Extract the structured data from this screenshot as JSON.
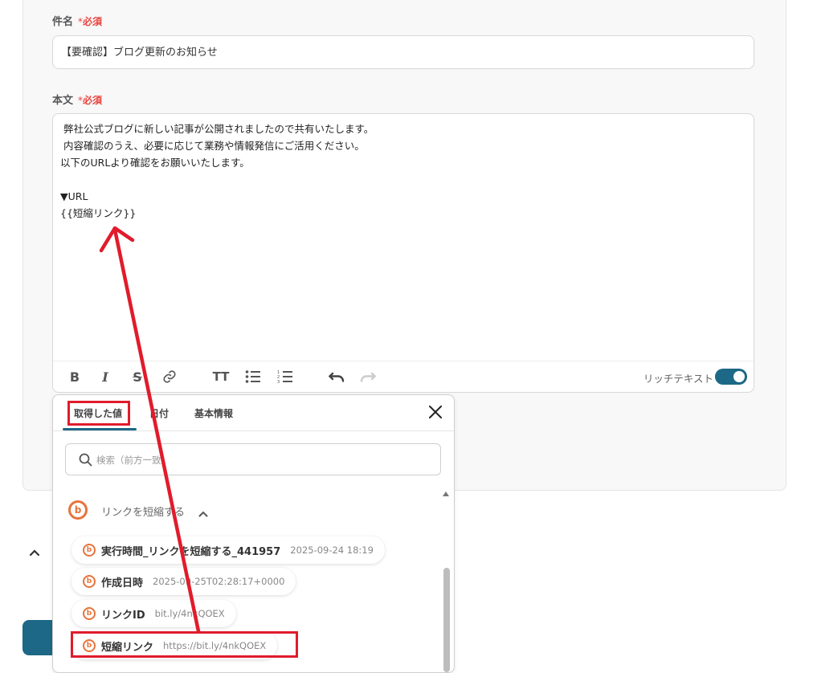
{
  "form": {
    "subject_label": "件名",
    "required_mark": "*",
    "required_text": "必須",
    "subject_value": "【要確認】ブログ更新のお知らせ",
    "body_label": "本文",
    "body_lines": [
      " 弊社公式ブログに新しい記事が公開されましたので共有いたします。",
      " 内容確認のうえ、必要に応じて業務や情報発信にご活用ください。",
      "以下のURLより確認をお願いいたします。",
      "",
      "▼URL",
      "{{短縮リンク}}"
    ],
    "rich_text_label": "リッチテキスト"
  },
  "popup": {
    "tabs": [
      "取得した値",
      "日付",
      "基本情報"
    ],
    "search_placeholder": "検索（前方一致）",
    "group_title": "リンクを短縮する",
    "items": [
      {
        "name": "実行時間_リンクを短縮する_441957",
        "value": "2025-09-24 18:19"
      },
      {
        "name": "作成日時",
        "value": "2025-09-25T02:28:17+0000"
      },
      {
        "name": "リンクID",
        "value": "bit.ly/4nkQOEX"
      },
      {
        "name": "短縮リンク",
        "value": "https://bit.ly/4nkQOEX"
      }
    ]
  },
  "colors": {
    "accent": "#1d6886",
    "required": "#e8433f",
    "bitly": "#e8733a",
    "annotation": "#e01c2c"
  }
}
